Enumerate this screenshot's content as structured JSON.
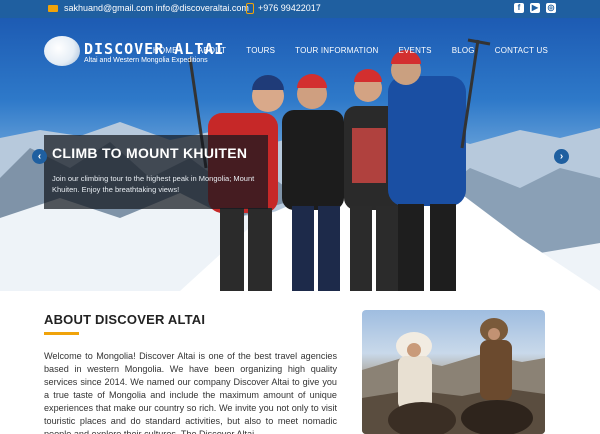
{
  "topbar": {
    "email": "sakhuand@gmail.com info@discoveraltai.com",
    "phone": "+976 99422017",
    "socials": [
      "facebook-icon",
      "youtube-icon",
      "instagram-icon"
    ]
  },
  "brand": {
    "name": "DISCOVER ALTAI",
    "tagline": "Altai and Western Mongolia Expeditions"
  },
  "nav": [
    "HOME",
    "ABOUT",
    "TOURS",
    "TOUR INFORMATION",
    "EVENTS",
    "BLOG",
    "CONTACT US"
  ],
  "slide": {
    "title": "CLIMB TO MOUNT KHUITEN",
    "text": "Join our climbing tour to the highest peak in Mongolia; Mount Khuiten. Enjoy the breathtaking views!"
  },
  "about": {
    "title": "ABOUT DISCOVER ALTAI",
    "text": "Welcome to Mongolia! Discover Altai is one of the best travel agencies based in western Mongolia. We have been organizing high quality services since 2014. We named our company Discover Altai to give you a true taste of Mongolia and include the maximum amount of unique experiences that make our country so rich. We invite you not only to visit touristic places and do standard activities, but also to meet nomadic people and explore their cultures. The Discover Altai"
  },
  "colors": {
    "primary": "#1f5fa0",
    "accent": "#f0a30a"
  }
}
